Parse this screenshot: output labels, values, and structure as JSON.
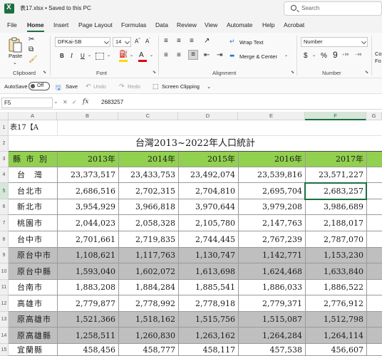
{
  "titlebar": {
    "filename": "表17.xlsx • Saved to this PC",
    "search_placeholder": "Search"
  },
  "menu": {
    "tabs": [
      "File",
      "Home",
      "Insert",
      "Page Layout",
      "Formulas",
      "Data",
      "Review",
      "View",
      "Automate",
      "Help",
      "Acrobat"
    ],
    "active": "Home"
  },
  "ribbon": {
    "paste_label": "Paste",
    "font_name": "DFKai-SB",
    "font_size": "14",
    "wrap_text": "Wrap Text",
    "merge_center": "Merge & Center",
    "number_format": "Number",
    "groups": {
      "clipboard": "Clipboard",
      "font": "Font",
      "alignment": "Alignment",
      "number": "Number"
    },
    "accent_color": "#1d6f42",
    "fill_color": "#ffd700",
    "font_color": "#e00000"
  },
  "qa": {
    "autosave": "AutoSave",
    "toggle": "Off",
    "save": "Save",
    "undo": "Undo",
    "redo": "Redo",
    "screen_clipping": "Screen Clipping"
  },
  "formula": {
    "namebox": "F5",
    "fx": "fx",
    "value": "2683257"
  },
  "sheet": {
    "columns": [
      "A",
      "B",
      "C",
      "D",
      "E",
      "F",
      "G"
    ],
    "selected_col": "F",
    "selected_row": "5",
    "row_numbers": [
      "1",
      "2",
      "3",
      "4",
      "5",
      "6",
      "7",
      "8",
      "9",
      "10",
      "11",
      "12",
      "13",
      "14",
      "15"
    ],
    "a1_text": "表17【A",
    "title": "台灣2013~2022年人口統計",
    "header": [
      "縣 市 別",
      "2013年",
      "2014年",
      "2015年",
      "2016年",
      "2017年"
    ],
    "header_fill": "#92d050",
    "gray_fill": "#bfbfbf",
    "rows": [
      {
        "name": "台　灣",
        "values": [
          "23,373,517",
          "23,433,753",
          "23,492,074",
          "23,539,816",
          "23,571,227"
        ],
        "gray": false
      },
      {
        "name": "台北市",
        "values": [
          "2,686,516",
          "2,702,315",
          "2,704,810",
          "2,695,704",
          "2,683,257"
        ],
        "gray": false
      },
      {
        "name": "新北市",
        "values": [
          "3,954,929",
          "3,966,818",
          "3,970,644",
          "3,979,208",
          "3,986,689"
        ],
        "gray": false
      },
      {
        "name": "桃園市",
        "values": [
          "2,044,023",
          "2,058,328",
          "2,105,780",
          "2,147,763",
          "2,188,017"
        ],
        "gray": false
      },
      {
        "name": "台中市",
        "values": [
          "2,701,661",
          "2,719,835",
          "2,744,445",
          "2,767,239",
          "2,787,070"
        ],
        "gray": false
      },
      {
        "name": "原台中市",
        "values": [
          "1,108,621",
          "1,117,763",
          "1,130,747",
          "1,142,771",
          "1,153,230"
        ],
        "gray": true
      },
      {
        "name": "原台中縣",
        "values": [
          "1,593,040",
          "1,602,072",
          "1,613,698",
          "1,624,468",
          "1,633,840"
        ],
        "gray": true
      },
      {
        "name": "台南市",
        "values": [
          "1,883,208",
          "1,884,284",
          "1,885,541",
          "1,886,033",
          "1,886,522"
        ],
        "gray": false
      },
      {
        "name": "高雄市",
        "values": [
          "2,779,877",
          "2,778,992",
          "2,778,918",
          "2,779,371",
          "2,776,912"
        ],
        "gray": false
      },
      {
        "name": "原高雄市",
        "values": [
          "1,521,366",
          "1,518,162",
          "1,515,756",
          "1,515,087",
          "1,512,798"
        ],
        "gray": true
      },
      {
        "name": "原高雄縣",
        "values": [
          "1,258,511",
          "1,260,830",
          "1,263,162",
          "1,264,284",
          "1,264,114"
        ],
        "gray": true
      },
      {
        "name": "宜蘭縣",
        "values": [
          "458,456",
          "458,777",
          "458,117",
          "457,538",
          "456,607"
        ],
        "gray": false
      }
    ]
  }
}
